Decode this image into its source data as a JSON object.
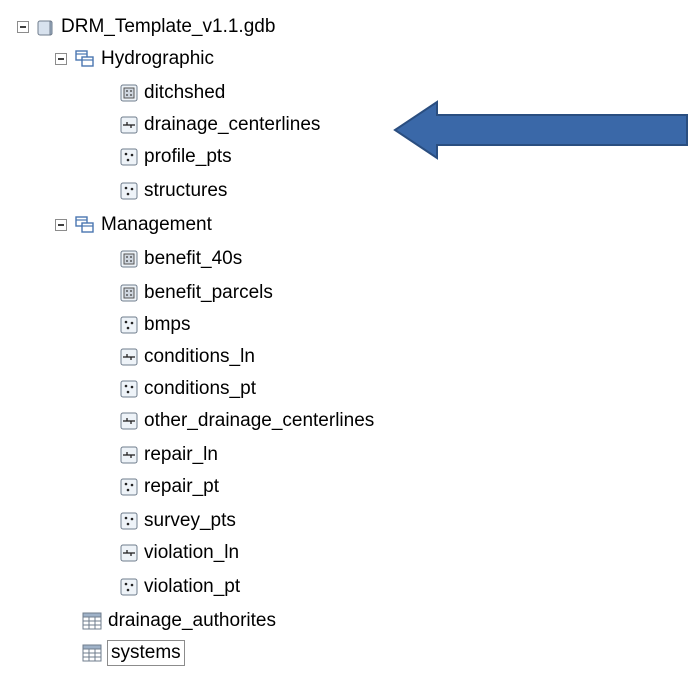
{
  "tree": {
    "root": {
      "label": "DRM_Template_v1.1.gdb",
      "icon": "database-icon"
    },
    "datasets": [
      {
        "label": "Hydrographic",
        "icon": "feature-dataset-icon",
        "items": [
          {
            "label": "ditchshed",
            "icon": "polygon-feature-class-icon"
          },
          {
            "label": "drainage_centerlines",
            "icon": "line-feature-class-icon"
          },
          {
            "label": "profile_pts",
            "icon": "point-feature-class-icon"
          },
          {
            "label": "structures",
            "icon": "point-feature-class-icon"
          }
        ]
      },
      {
        "label": "Management",
        "icon": "feature-dataset-icon",
        "items": [
          {
            "label": "benefit_40s",
            "icon": "polygon-feature-class-icon"
          },
          {
            "label": "benefit_parcels",
            "icon": "polygon-feature-class-icon"
          },
          {
            "label": "bmps",
            "icon": "point-feature-class-icon"
          },
          {
            "label": "conditions_ln",
            "icon": "line-feature-class-icon"
          },
          {
            "label": "conditions_pt",
            "icon": "point-feature-class-icon"
          },
          {
            "label": "other_drainage_centerlines",
            "icon": "line-feature-class-icon"
          },
          {
            "label": "repair_ln",
            "icon": "line-feature-class-icon"
          },
          {
            "label": "repair_pt",
            "icon": "point-feature-class-icon"
          },
          {
            "label": "survey_pts",
            "icon": "point-feature-class-icon"
          },
          {
            "label": "violation_ln",
            "icon": "line-feature-class-icon"
          },
          {
            "label": "violation_pt",
            "icon": "point-feature-class-icon"
          }
        ]
      }
    ],
    "tables": [
      {
        "label": "drainage_authorites",
        "icon": "table-icon"
      },
      {
        "label": "systems",
        "icon": "table-icon"
      }
    ]
  },
  "annotation": {
    "icon": "left-arrow-icon",
    "color": "#3a68a8",
    "border_color": "#2a4e80"
  },
  "colors": {
    "icon_border": "#6f7c8c",
    "icon_fill": "#eef3f8",
    "dataset_blue": "#4a76b0"
  }
}
